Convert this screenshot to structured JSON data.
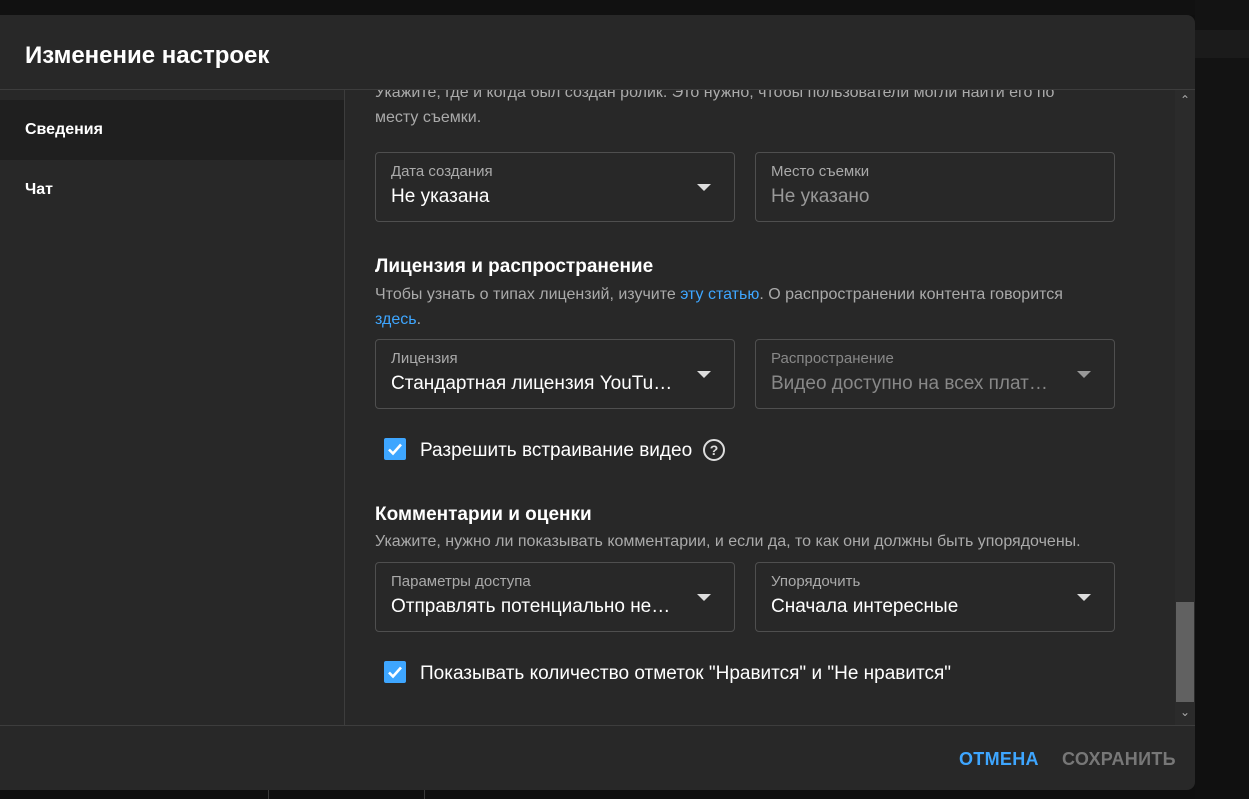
{
  "dialog": {
    "title": "Изменение настроек"
  },
  "sidebar": {
    "items": [
      {
        "label": "Сведения",
        "active": true
      },
      {
        "label": "Чат",
        "active": false
      }
    ]
  },
  "recording": {
    "description_line1": "Укажите, где и когда был создан ролик. Это нужно, чтобы пользователи могли найти его по",
    "description_line2": "месту съемки.",
    "date_label": "Дата создания",
    "date_value": "Не указана",
    "location_label": "Место съемки",
    "location_placeholder": "Не указано"
  },
  "license": {
    "heading": "Лицензия и распространение",
    "desc_part1": "Чтобы узнать о типах лицензий, изучите ",
    "desc_link1": "эту статью",
    "desc_part2": ". О распространении контента говорится",
    "desc_link2": "здесь",
    "desc_part3": ".",
    "license_label": "Лицензия",
    "license_value": "Стандартная лицензия YouTu…",
    "distribution_label": "Распространение",
    "distribution_value": "Видео доступно на всех плат…",
    "embed_label": "Разрешить встраивание видео",
    "embed_checked": true,
    "help_glyph": "?"
  },
  "comments": {
    "heading": "Комментарии и оценки",
    "description": "Укажите, нужно ли показывать комментарии, и если да, то как они должны быть упорядочены.",
    "access_label": "Параметры доступа",
    "access_value": "Отправлять потенциально не…",
    "sort_label": "Упорядочить",
    "sort_value": "Сначала интересные",
    "likes_label": "Показывать количество отметок \"Нравится\" и \"Не нравится\"",
    "likes_checked": true
  },
  "scrollbar": {
    "up_glyph": "⌃",
    "down_glyph": "⌄"
  },
  "footer": {
    "cancel_label": "ОТМЕНА",
    "save_label": "СОХРАНИТЬ"
  },
  "colors": {
    "accent": "#3ea6ff",
    "dialog_bg": "#282828",
    "disabled_text": "#777777"
  },
  "icons": {
    "dropdown": "chevron-down-icon",
    "checkbox": "check-icon",
    "help": "help-circle-icon"
  }
}
